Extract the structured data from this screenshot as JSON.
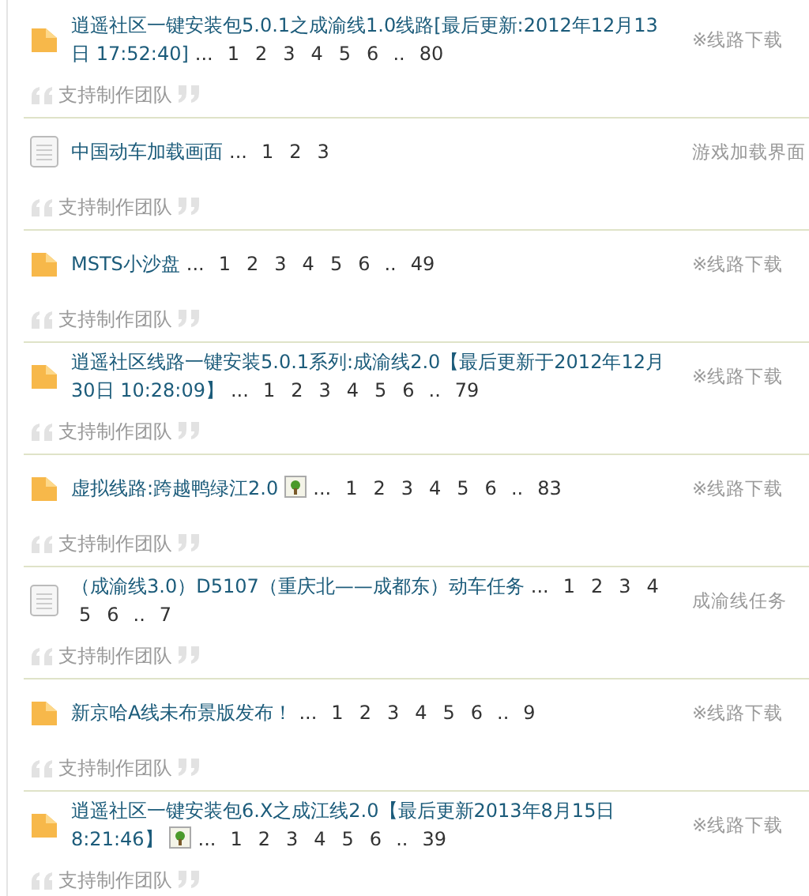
{
  "topics": [
    {
      "kind": "folder",
      "title": [
        "逍遥社区一键安装包5.0.1之成渝线1.0线路[最后更新:2012年12月13",
        "日 17:52:40]"
      ],
      "image": false,
      "more": "...",
      "pages": [
        "1",
        "2",
        "3",
        "4",
        "5",
        "6"
      ],
      "gap": "..",
      "last_page": "80",
      "category": "※线路下载",
      "footer": "支持制作团队"
    },
    {
      "kind": "document",
      "title": [
        "中国动车加载画面"
      ],
      "image": false,
      "more": "...",
      "pages": [
        "1",
        "2",
        "3"
      ],
      "category": "游戏加载界面",
      "footer": "支持制作团队"
    },
    {
      "kind": "folder",
      "title": [
        "MSTS小沙盘"
      ],
      "image": false,
      "more": "...",
      "pages": [
        "1",
        "2",
        "3",
        "4",
        "5",
        "6"
      ],
      "gap": "..",
      "last_page": "49",
      "category": "※线路下载",
      "footer": "支持制作团队"
    },
    {
      "kind": "folder",
      "title": [
        "逍遥社区线路一键安装5.0.1系列:成渝线2.0【最后更新于2012年12月",
        "30日 10:28:09】"
      ],
      "image": false,
      "more": "...",
      "pages": [
        "1",
        "2",
        "3",
        "4",
        "5",
        "6"
      ],
      "gap": "..",
      "last_page": "79",
      "category": "※线路下载",
      "footer": "支持制作团队"
    },
    {
      "kind": "folder",
      "title": [
        "虚拟线路:跨越鸭绿江2.0"
      ],
      "image": true,
      "more": "...",
      "pages": [
        "1",
        "2",
        "3",
        "4",
        "5",
        "6"
      ],
      "gap": "..",
      "last_page": "83",
      "category": "※线路下载",
      "footer": "支持制作团队"
    },
    {
      "kind": "document",
      "title": [
        "（成渝线3.0）D5107（重庆北——成都东）动车任务"
      ],
      "image": false,
      "more": "...",
      "pages": [
        "1",
        "2",
        "3",
        "4",
        "5",
        "6"
      ],
      "gap": "..",
      "last_page": "7",
      "category": "成渝线任务",
      "footer": "支持制作团队"
    },
    {
      "kind": "folder",
      "title": [
        "新京哈A线未布景版发布！"
      ],
      "image": false,
      "more": "...",
      "pages": [
        "1",
        "2",
        "3",
        "4",
        "5",
        "6"
      ],
      "gap": "..",
      "last_page": "9",
      "category": "※线路下载",
      "footer": "支持制作团队"
    },
    {
      "kind": "folder",
      "title": [
        "逍遥社区一键安装包6.X之成江线2.0【最后更新2013年8月15日",
        "8:21:46】"
      ],
      "image": true,
      "more": "...",
      "pages": [
        "1",
        "2",
        "3",
        "4",
        "5",
        "6"
      ],
      "gap": "..",
      "last_page": "39",
      "category": "※线路下载",
      "footer": "支持制作团队"
    }
  ]
}
